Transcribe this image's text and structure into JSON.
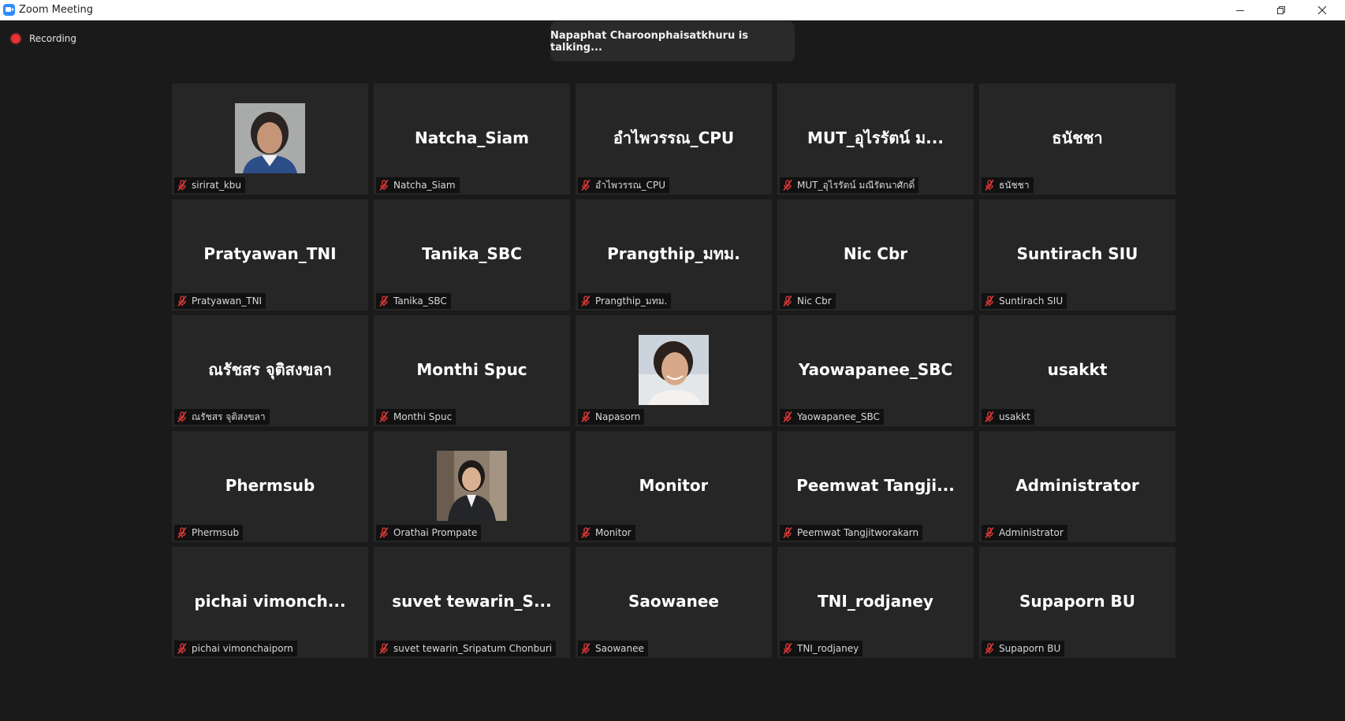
{
  "window": {
    "title": "Zoom Meeting",
    "controls": [
      "minimize-icon",
      "restore-icon",
      "close-icon"
    ]
  },
  "recording": {
    "label": "Recording",
    "indicator_color": "#e63333"
  },
  "speaker_banner": {
    "text": "Napaphat Charoonphaisatkhuru is talking..."
  },
  "colors": {
    "background": "#1a1a1a",
    "tile": "#262626",
    "muted_mic": "#e23b3b"
  },
  "participants": [
    {
      "display": "",
      "label": "sirirat_kbu",
      "video": true,
      "muted": true
    },
    {
      "display": "Natcha_Siam",
      "label": "Natcha_Siam",
      "video": false,
      "muted": true
    },
    {
      "display": "อำไพวรรณ_CPU",
      "label": "อำไพวรรณ_CPU",
      "video": false,
      "muted": true
    },
    {
      "display": "MUT_อุไรรัตน์ ม...",
      "label": "MUT_อุไรรัตน์ มณีรัตนาศักดิ์",
      "video": false,
      "muted": true
    },
    {
      "display": "ธนัชชา",
      "label": "ธนัชชา",
      "video": false,
      "muted": true
    },
    {
      "display": "Pratyawan_TNI",
      "label": "Pratyawan_TNI",
      "video": false,
      "muted": true
    },
    {
      "display": "Tanika_SBC",
      "label": "Tanika_SBC",
      "video": false,
      "muted": true
    },
    {
      "display": "Prangthip_มทม.",
      "label": "Prangthip_มทม.",
      "video": false,
      "muted": true
    },
    {
      "display": "Nic Cbr",
      "label": "Nic Cbr",
      "video": false,
      "muted": true
    },
    {
      "display": "Suntirach SIU",
      "label": "Suntirach SIU",
      "video": false,
      "muted": true
    },
    {
      "display": "ณรัชสร จุติสงขลา",
      "label": "ณรัชสร จุติสงขลา",
      "video": false,
      "muted": true
    },
    {
      "display": "Monthi Spuc",
      "label": "Monthi Spuc",
      "video": false,
      "muted": true
    },
    {
      "display": "",
      "label": "Napasorn",
      "video": true,
      "muted": true
    },
    {
      "display": "Yaowapanee_SBC",
      "label": "Yaowapanee_SBC",
      "video": false,
      "muted": true
    },
    {
      "display": "usakkt",
      "label": "usakkt",
      "video": false,
      "muted": true
    },
    {
      "display": "Phermsub",
      "label": "Phermsub",
      "video": false,
      "muted": true
    },
    {
      "display": "",
      "label": "Orathai Prompate",
      "video": true,
      "muted": true
    },
    {
      "display": "Monitor",
      "label": "Monitor",
      "video": false,
      "muted": true
    },
    {
      "display": "Peemwat  Tangji...",
      "label": "Peemwat Tangjitworakarn",
      "video": false,
      "muted": true
    },
    {
      "display": "Administrator",
      "label": "Administrator",
      "video": false,
      "muted": true
    },
    {
      "display": "pichai  vimonch...",
      "label": "pichai vimonchaiporn",
      "video": false,
      "muted": true
    },
    {
      "display": "suvet  tewarin_S...",
      "label": "suvet tewarin_Sripatum Chonburi",
      "video": false,
      "muted": true
    },
    {
      "display": "Saowanee",
      "label": "Saowanee",
      "video": false,
      "muted": true
    },
    {
      "display": "TNI_rodjaney",
      "label": "TNI_rodjaney",
      "video": false,
      "muted": true
    },
    {
      "display": "Supaporn BU",
      "label": "Supaporn BU",
      "video": false,
      "muted": true
    }
  ]
}
